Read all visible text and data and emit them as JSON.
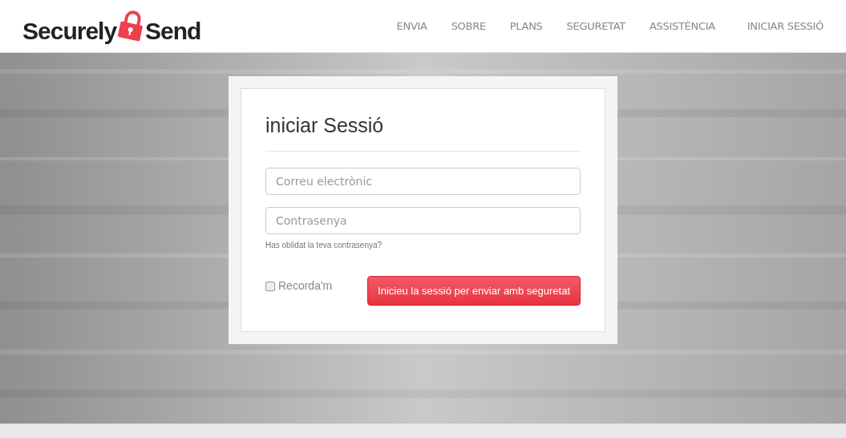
{
  "logo": {
    "part_1": "Securely",
    "part_2": "Send"
  },
  "nav": [
    {
      "label": "ENVIA"
    },
    {
      "label": "SOBRE"
    },
    {
      "label": "PLANS"
    },
    {
      "label": "SEGURETAT"
    },
    {
      "label": "ASSISTÈNCIA"
    },
    {
      "label": "INICIAR SESSIÓ"
    }
  ],
  "login": {
    "title": "iniciar Sessió",
    "email": {
      "placeholder": "Correu electrònic"
    },
    "password": {
      "placeholder": "Contrasenya"
    },
    "forgot_link": "Has oblidat la teva contrasenya?",
    "remember": {
      "label": "Recorda'm",
      "checked": false
    },
    "submit": "Inicieu la sessió per enviar amb seguretat"
  }
}
